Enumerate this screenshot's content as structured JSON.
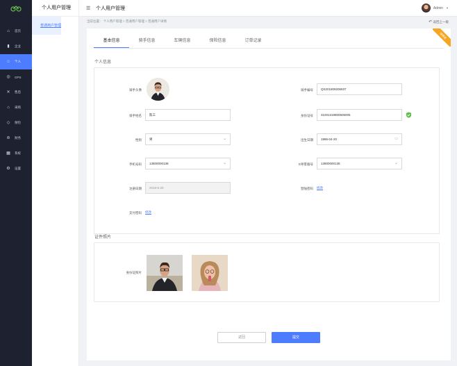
{
  "rail": {
    "items": [
      {
        "label": "首页",
        "icon": "home-icon"
      },
      {
        "label": "企业",
        "icon": "building-icon"
      },
      {
        "label": "个人",
        "icon": "person-icon"
      },
      {
        "label": "GPS",
        "icon": "gps-icon"
      },
      {
        "label": "售后",
        "icon": "wrench-icon"
      },
      {
        "label": "采购",
        "icon": "cart-icon"
      },
      {
        "label": "保险",
        "icon": "shield-icon"
      },
      {
        "label": "财务",
        "icon": "wallet-icon"
      },
      {
        "label": "系统",
        "icon": "grid-icon"
      },
      {
        "label": "设置",
        "icon": "gear-icon"
      }
    ],
    "active_index": 2
  },
  "submenu": {
    "title": "个人用户管理",
    "items": [
      "骑手用户管理",
      "普通用户管理"
    ],
    "active_index": 1
  },
  "header": {
    "page_title": "个人用户管理",
    "user_name": "Admin"
  },
  "breadcrumb": "当前位置： 个人用户管理 > 普通用户管理 > 普通用户详情",
  "back_label": "返回上一级",
  "ribbon": "待审核",
  "tabs": [
    "基本信息",
    "骑手信息",
    "车辆信息",
    "保险信息",
    "订单记录"
  ],
  "active_tab": 0,
  "section_personal": "个人信息",
  "section_documents": "证件照片",
  "form": {
    "avatar_label": "骑手头像",
    "rider_no_label": "骑手编号",
    "rider_no": "QS201809206937",
    "name_label": "骑手姓名",
    "name": "陈三",
    "id_label": "身份证号",
    "id_no": "31001319900605005",
    "gender_label": "性别",
    "gender": "男",
    "birth_label": "出生日期",
    "birth": "1986-04-20",
    "phone_label": "手机号码",
    "phone": "13800000138",
    "e_phone_label": "E呼客服号",
    "e_phone": "13800000138",
    "reg_label": "注册日期",
    "reg_date": "2018-5-20",
    "login_pwd_label": "登陆密码",
    "login_pwd_action": "修改",
    "pay_pwd_label": "支付密码",
    "pay_pwd_action": "修改",
    "id_photo_label": "身份证照片"
  },
  "buttons": {
    "reset": "返回",
    "submit": "提交"
  },
  "colors": {
    "accent": "#4d7cfe",
    "rail": "#1e2230",
    "ribbon": "#f5a623"
  }
}
